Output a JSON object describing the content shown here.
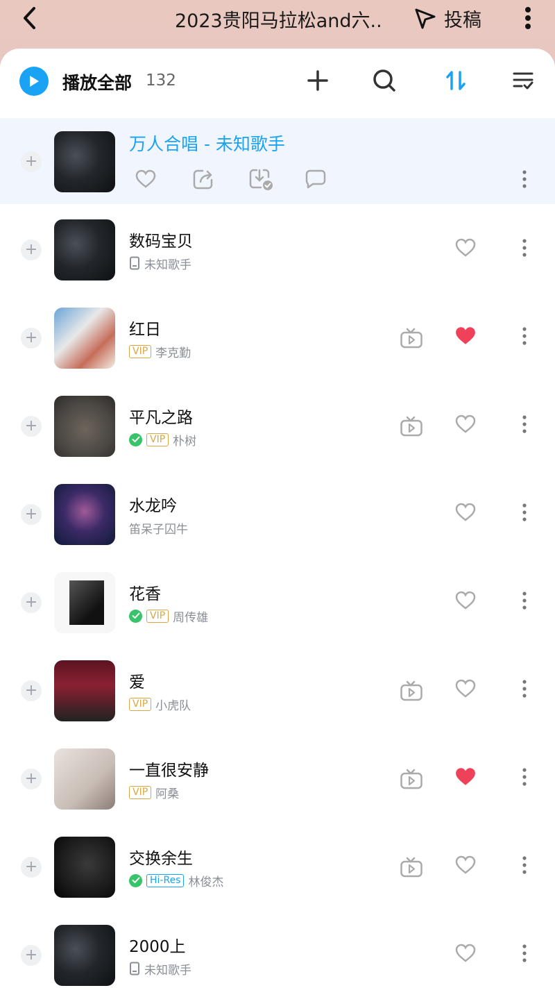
{
  "topbar": {
    "title": "2023贵阳马拉松and六..",
    "submit_label": "投稿"
  },
  "header": {
    "play_all_label": "播放全部",
    "count": "132"
  },
  "songs": [
    {
      "title": "万人合唱 - 未知歌手",
      "playing": true,
      "cover": "vinyl-disc"
    },
    {
      "title": "数码宝贝",
      "local": true,
      "artist": "未知歌手",
      "liked": false,
      "cover": "vinyl-disc"
    },
    {
      "title": "红日",
      "vip": "VIP",
      "artist": "李克勤",
      "mv": true,
      "liked": true,
      "cover": "album-art"
    },
    {
      "title": "平凡之路",
      "verified": true,
      "vip": "VIP",
      "artist": "朴树",
      "mv": true,
      "liked": false,
      "cover": "album-art"
    },
    {
      "title": "水龙吟",
      "artist": "笛呆子囚牛",
      "liked": false,
      "cover": "album-art"
    },
    {
      "title": "花香",
      "verified": true,
      "vip": "VIP",
      "artist": "周传雄",
      "liked": false,
      "cover": "album-art"
    },
    {
      "title": "爱",
      "vip": "VIP",
      "artist": "小虎队",
      "mv": true,
      "liked": false,
      "cover": "album-art"
    },
    {
      "title": "一直很安静",
      "vip": "VIP",
      "artist": "阿桑",
      "mv": true,
      "liked": true,
      "cover": "album-art"
    },
    {
      "title": "交换余生",
      "verified": true,
      "quality": "Hi-Res",
      "artist": "林俊杰",
      "mv": true,
      "liked": false,
      "cover": "album-art"
    },
    {
      "title": "2000上",
      "local": true,
      "artist": "未知歌手",
      "liked": false,
      "cover": "vinyl-disc"
    }
  ],
  "colors": {
    "accent": "#1aa3f5",
    "liked": "#f0415a",
    "vip": "#d9a645",
    "verified": "#39c36a"
  }
}
